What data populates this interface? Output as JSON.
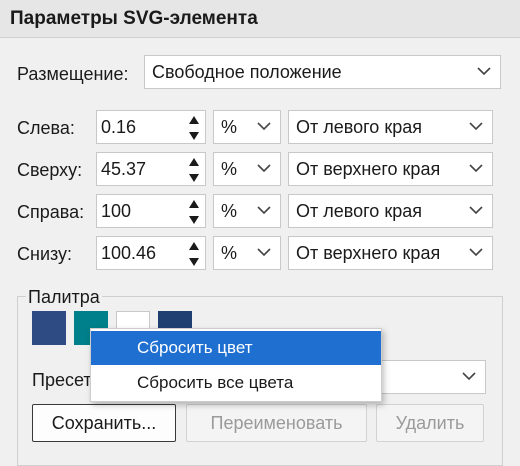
{
  "panel": {
    "title": "Параметры SVG-элемента"
  },
  "placement": {
    "label": "Размещение:",
    "value": "Свободное положение"
  },
  "rows": [
    {
      "label": "Слева:",
      "value": "0.16",
      "unit": "%",
      "ref": "От левого края"
    },
    {
      "label": "Сверху:",
      "value": "45.37",
      "unit": "%",
      "ref": "От верхнего края"
    },
    {
      "label": "Справа:",
      "value": "100",
      "unit": "%",
      "ref": "От левого края"
    },
    {
      "label": "Снизу:",
      "value": "100.46",
      "unit": "%",
      "ref": "От верхнего края"
    }
  ],
  "palette": {
    "title": "Палитра",
    "swatches": [
      "#2e4c83",
      "#00808a",
      "#ffffff",
      "#1f3f73"
    ],
    "preset_label": "Пресет"
  },
  "context_menu": {
    "items": [
      "Сбросить цвет",
      "Сбросить все цвета"
    ],
    "highlight_color": "#1f6fd0"
  },
  "buttons": {
    "save": "Сохранить...",
    "rename": "Переименовать",
    "delete": "Удалить"
  }
}
